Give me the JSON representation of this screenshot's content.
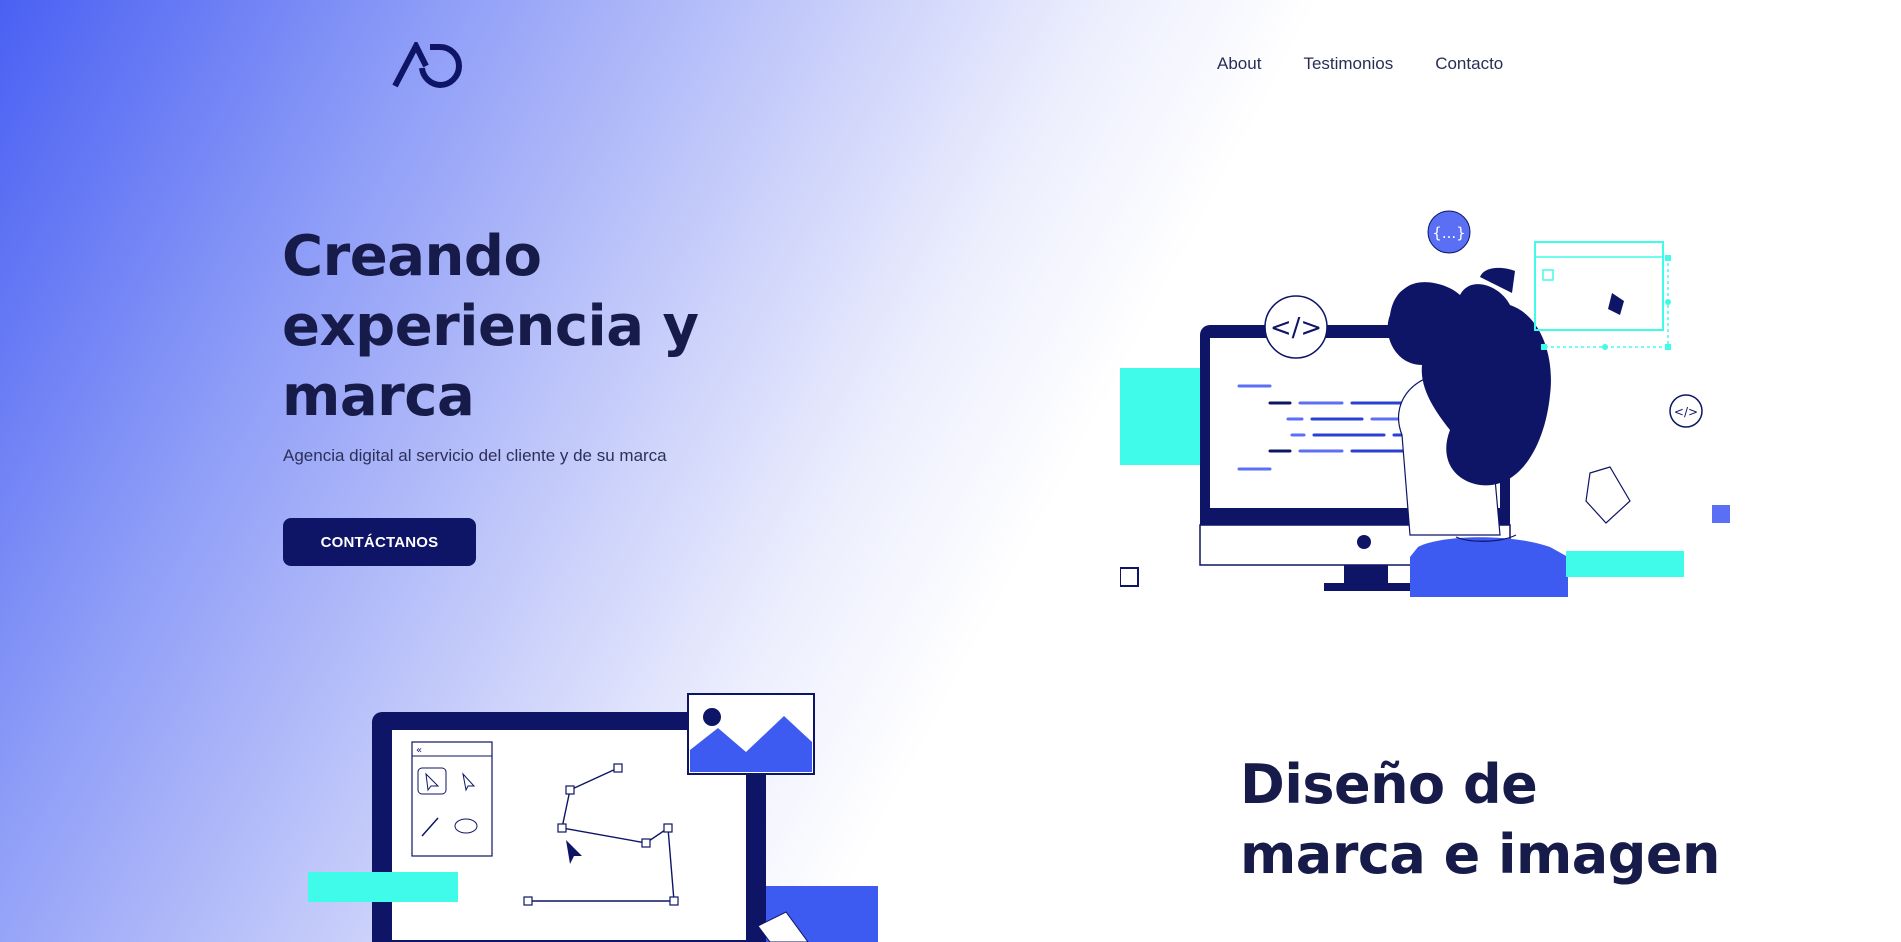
{
  "header": {
    "nav": [
      {
        "label": "About"
      },
      {
        "label": "Testimonios"
      },
      {
        "label": "Contacto"
      }
    ]
  },
  "hero": {
    "title": "Creando experiencia y marca",
    "subtitle": "Agencia digital al servicio del cliente y de su marca",
    "cta_label": "CONTÁCTANOS"
  },
  "illustration_dev": {
    "code_tag": "</>",
    "json_badge": "{...}",
    "small_code_tag": "</>"
  },
  "section_branding": {
    "title": "Diseño de marca e imagen"
  },
  "icons": [
    "ad-logo",
    "code-tag-icon",
    "json-braces-icon",
    "pen-tool-icon",
    "cursor-icon",
    "image-icon"
  ],
  "colors": {
    "navy": "#0e1566",
    "accent_blue": "#4a60f3",
    "cyan": "#40fbe9",
    "text_dark": "#171b49"
  }
}
